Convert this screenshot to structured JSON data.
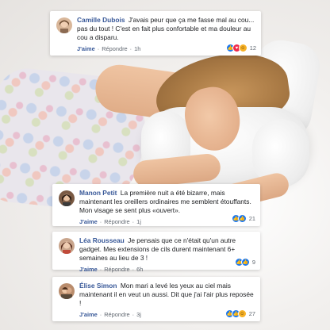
{
  "comments": [
    {
      "author": "Camille Dubois",
      "text": "J'avais peur que ça me fasse mal au cou... pas du tout ! C'est en fait plus confortable et ma douleur au cou a disparu.",
      "like_label": "J'aime",
      "reply_label": "Répondre",
      "time": "1h",
      "reactions": [
        "like",
        "love",
        "haha"
      ],
      "reaction_count": "12"
    },
    {
      "author": "Manon Petit",
      "text": "La première nuit a été bizarre, mais maintenant les oreillers ordinaires me semblent étouffants. Mon visage se sent plus «ouvert».",
      "like_label": "J'aime",
      "reply_label": "Répondre",
      "time": "1j",
      "reactions": [
        "like",
        "like"
      ],
      "reaction_count": "21"
    },
    {
      "author": "Léa Rousseau",
      "text": "Je pensais que ce n'était qu'un autre gadget. Mes extensions de cils durent maintenant 6+ semaines au lieu de 3 !",
      "like_label": "J'aime",
      "reply_label": "Répondre",
      "time": "6h",
      "reactions": [
        "like",
        "like"
      ],
      "reaction_count": "9"
    },
    {
      "author": "Élise Simon",
      "text": "Mon mari a levé les yeux au ciel mais maintenant il en veut un aussi. Dit que j'ai l'air plus reposée !",
      "like_label": "J'aime",
      "reply_label": "Répondre",
      "time": "3j",
      "reactions": [
        "like",
        "like",
        "haha"
      ],
      "reaction_count": "27"
    }
  ],
  "colors": {
    "author": "#385898",
    "like_blue": "#1877f2",
    "love_red": "#f0284a",
    "haha_yellow": "#f7b125"
  }
}
